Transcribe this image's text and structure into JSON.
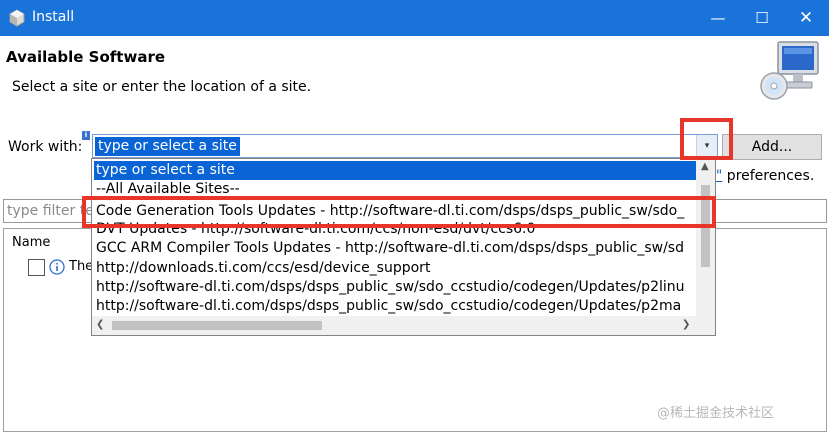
{
  "window": {
    "title": "Install",
    "min_glyph": "—",
    "max_glyph": "☐",
    "close_glyph": "✕"
  },
  "header": {
    "title": "Available Software",
    "description": "Select a site or enter the location of a site."
  },
  "work_with": {
    "label": "Work with:",
    "value": "type or select a site",
    "arrow_glyph": "▾",
    "add_label": "Add..."
  },
  "preferences": {
    "link_text": "es\"",
    "text": " preferences."
  },
  "filter": {
    "placeholder": "type filter te"
  },
  "table": {
    "column_name": "Name",
    "rows": [
      {
        "label": "The"
      }
    ]
  },
  "dropdown": {
    "items": [
      "type or select a site",
      "--All Available Sites--",
      "Code Generation Tools Updates - http://software-dl.ti.com/dsps/dsps_public_sw/sdo_",
      "DVT Updates - http://software-dl.ti.com/ccs/non-esd/dvt/ccs6.0",
      "GCC ARM Compiler Tools Updates - http://software-dl.ti.com/dsps/dsps_public_sw/sd",
      "http://downloads.ti.com/ccs/esd/device_support",
      "http://software-dl.ti.com/dsps/dsps_public_sw/sdo_ccstudio/codegen/Updates/p2linu",
      "http://software-dl.ti.com/dsps/dsps_public_sw/sdo_ccstudio/codegen/Updates/p2ma"
    ],
    "selected_index": 0,
    "scroll_left_glyph": "❮",
    "scroll_right_glyph": "❯",
    "scroll_up_glyph": "▲",
    "scroll_down_glyph": "▼"
  },
  "watermark": "@稀土掘金技术社区",
  "colors": {
    "titlebar": "#1a73d9",
    "selection": "#0a64d6",
    "highlight": "#e8352a",
    "link": "#1565c0"
  },
  "icons": {
    "app": "eclipse-icon",
    "header_art": "computer-cd-icon",
    "info": "info-icon"
  }
}
